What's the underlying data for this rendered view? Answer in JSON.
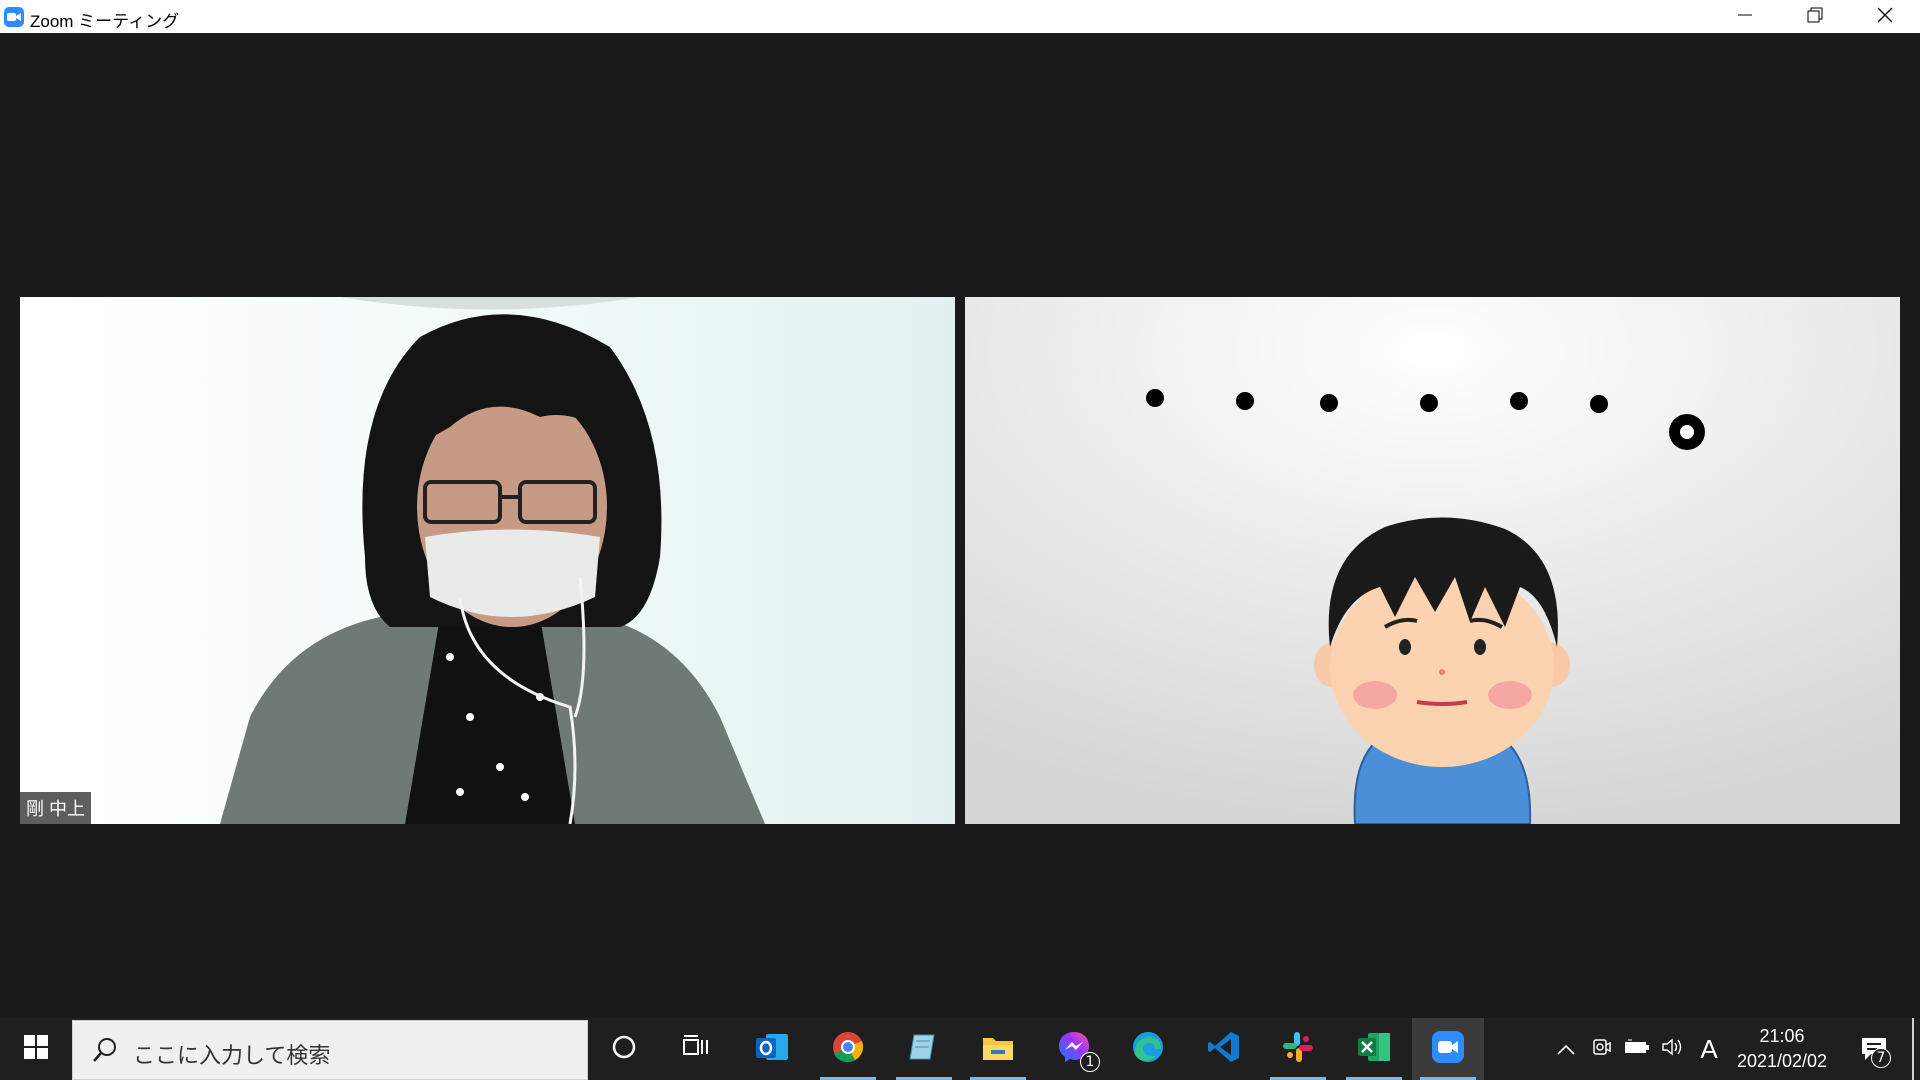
{
  "window": {
    "title": "Zoom ミーティング",
    "icon": "zoom-camera-icon",
    "controls": [
      "minimize-icon",
      "restore-icon",
      "close-icon"
    ]
  },
  "participants": [
    {
      "name": "剛 中上",
      "video": "camera-person-with-mask"
    },
    {
      "name": "",
      "video": "illustration-boy-with-dots"
    }
  ],
  "taskbar": {
    "search_placeholder": "ここに入力して検索",
    "apps": [
      {
        "name": "cortana-icon"
      },
      {
        "name": "task-view-icon"
      },
      {
        "name": "outlook-icon"
      },
      {
        "name": "chrome-icon"
      },
      {
        "name": "notepad-icon"
      },
      {
        "name": "file-explorer-icon"
      },
      {
        "name": "messenger-icon",
        "badge": "1"
      },
      {
        "name": "edge-icon"
      },
      {
        "name": "vscode-icon"
      },
      {
        "name": "slack-icon"
      },
      {
        "name": "excel-icon"
      },
      {
        "name": "zoom-icon"
      }
    ],
    "ime": "A",
    "time": "21:06",
    "date": "2021/02/02",
    "notification_count": "7"
  },
  "colors": {
    "zoom_blue": "#2d8cff",
    "taskbar_bg": "#1f1f1f",
    "stage_bg": "#1a1a1a",
    "active_underline": "#76b9ed"
  }
}
